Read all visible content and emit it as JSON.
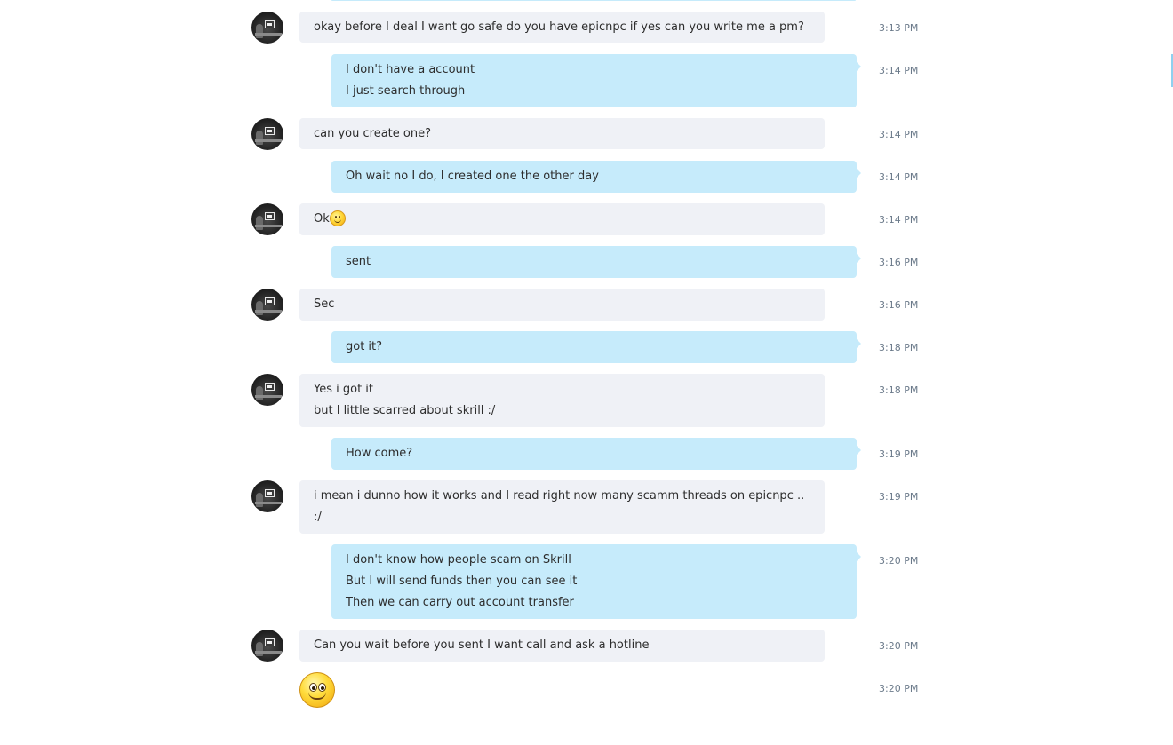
{
  "messages": [
    {
      "dir": "in",
      "lines": [
        "okay before I deal I want go safe do you have epicnpc if yes can you write me a pm?"
      ],
      "time": "3:13 PM"
    },
    {
      "dir": "out",
      "lines": [
        "I don't have a account",
        "I just search through"
      ],
      "time": "3:14 PM"
    },
    {
      "dir": "in",
      "lines": [
        "can you create one?"
      ],
      "time": "3:14 PM"
    },
    {
      "dir": "out",
      "lines": [
        "Oh wait no I do, I created one the other day"
      ],
      "time": "3:14 PM"
    },
    {
      "dir": "in",
      "lines": [
        "Ok"
      ],
      "emoji": "smile-emoji",
      "time": "3:14 PM"
    },
    {
      "dir": "out",
      "lines": [
        "sent"
      ],
      "time": "3:16 PM"
    },
    {
      "dir": "in",
      "lines": [
        "Sec"
      ],
      "time": "3:16 PM"
    },
    {
      "dir": "out",
      "lines": [
        "got it?"
      ],
      "time": "3:18 PM"
    },
    {
      "dir": "in",
      "lines": [
        "Yes i got it",
        "but I little scarred about skrill :/"
      ],
      "time": "3:18 PM"
    },
    {
      "dir": "out",
      "lines": [
        "How come?"
      ],
      "time": "3:19 PM"
    },
    {
      "dir": "in",
      "lines": [
        "i mean i dunno how it works and I read right now many scamm threads on epicnpc ..",
        ":/"
      ],
      "time": "3:19 PM"
    },
    {
      "dir": "out",
      "lines": [
        "I don't know how people scam on Skrill",
        "But I will send funds then you can see it",
        "Then we can carry out account transfer"
      ],
      "time": "3:20 PM"
    },
    {
      "dir": "in",
      "lines": [
        "Can you wait before you sent I want call and ask a hotline"
      ],
      "time": "3:20 PM"
    },
    {
      "dir": "in",
      "lines": [],
      "big_emoji": "big-smile-emoji",
      "time": "3:20 PM"
    }
  ],
  "colors": {
    "incoming_bubble": "#eff1f6",
    "outgoing_bubble": "#c6ebfb",
    "timestamp": "#6b7a8a"
  }
}
